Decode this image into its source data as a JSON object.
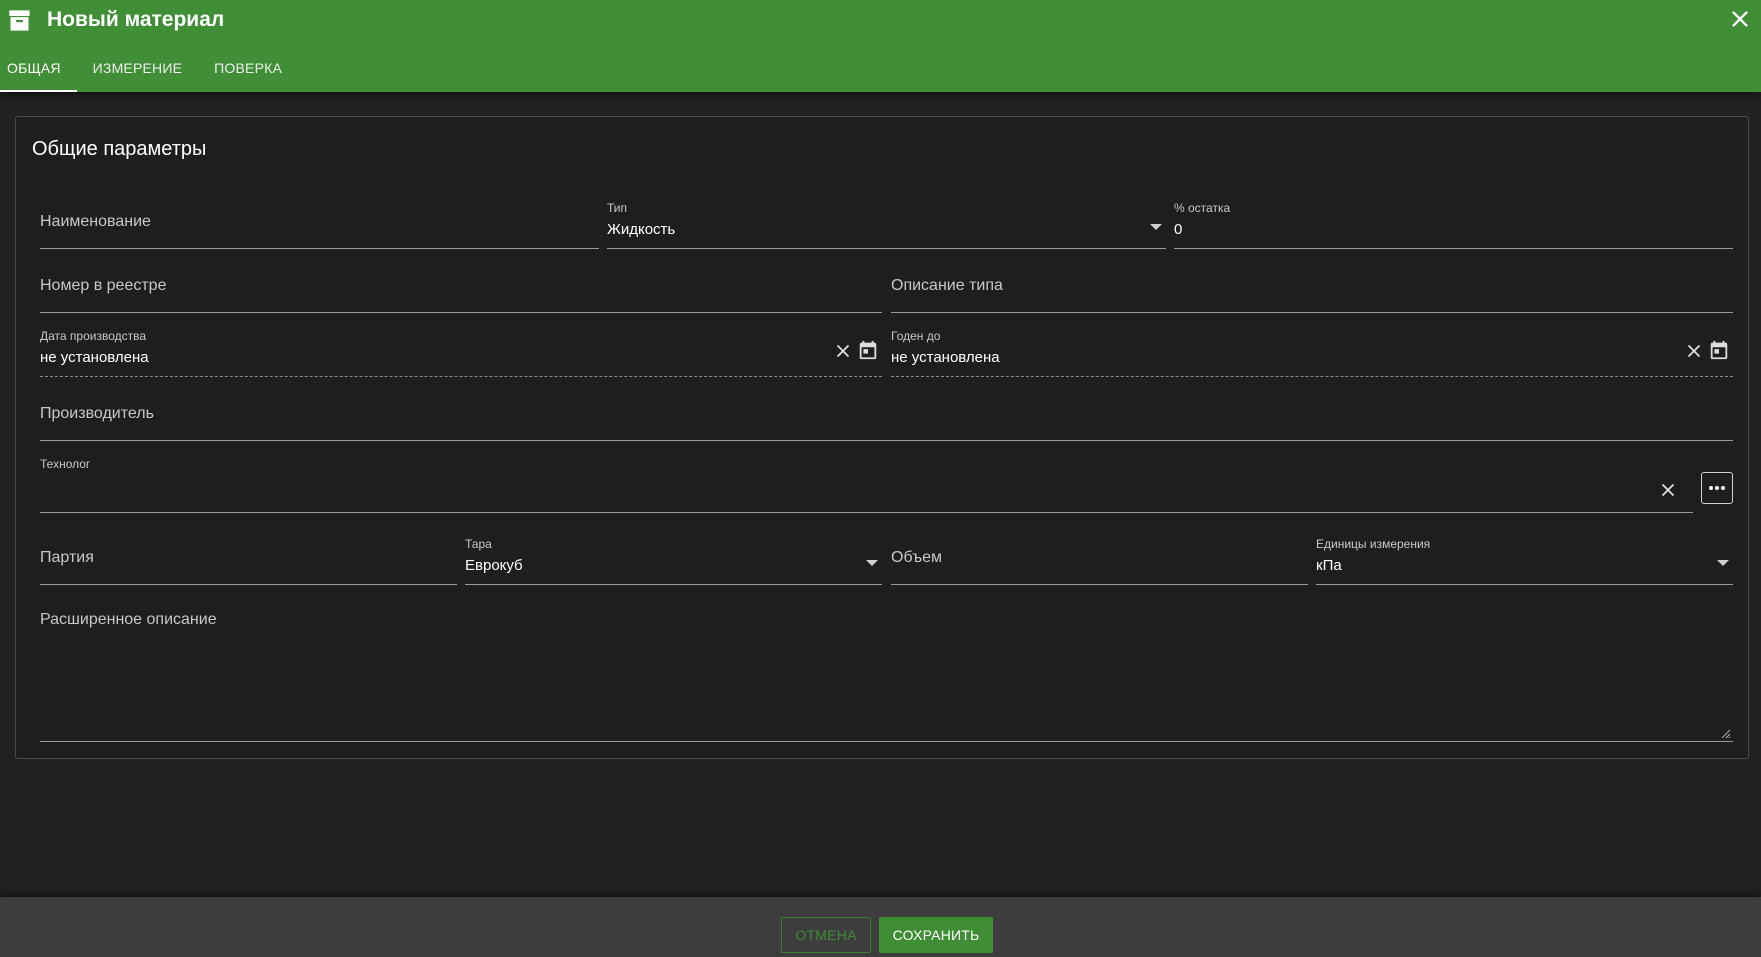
{
  "window": {
    "title": "Новый материал",
    "tabs": [
      "ОБЩАЯ",
      "ИЗМЕРЕНИЕ",
      "ПОВЕРКА"
    ],
    "active_tab": "ОБЩАЯ",
    "accent_color": "#408e36"
  },
  "card": {
    "title": "Общие параметры",
    "name_placeholder": "Наименование",
    "type": {
      "label": "Тип",
      "value": "Жидкость"
    },
    "remainder": {
      "label": "% остатка",
      "value": "0"
    },
    "registry_placeholder": "Номер в реестре",
    "type_description_placeholder": "Описание типа",
    "production_date": {
      "label": "Дата производства",
      "value": "не установлена"
    },
    "expiry_date": {
      "label": "Годен до",
      "value": "не установлена"
    },
    "manufacturer_placeholder": "Производитель",
    "technologist": {
      "label": "Технолог",
      "value": ""
    },
    "batch_placeholder": "Партия",
    "container": {
      "label": "Тара",
      "value": "Еврокуб"
    },
    "volume_placeholder": "Объем",
    "units": {
      "label": "Единицы измерения",
      "value": "кПа"
    },
    "extended_description_placeholder": "Расширенное описание"
  },
  "footer": {
    "cancel_label": "ОТМЕНА",
    "save_label": "СОХРАНИТЬ"
  }
}
